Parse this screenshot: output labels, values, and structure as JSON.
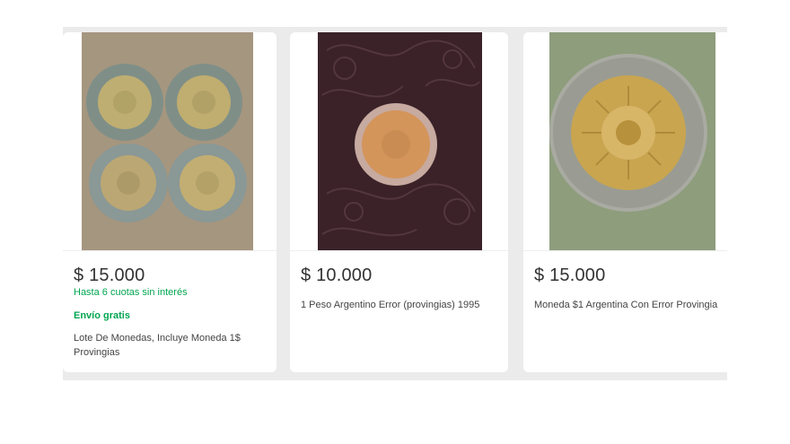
{
  "listings": [
    {
      "price": "$ 15.000",
      "installments": "Hasta 6 cuotas sin interés",
      "shipping": "Envío gratis",
      "title": "Lote De Monedas, Incluye Moneda 1$ Provingias"
    },
    {
      "price": "$ 10.000",
      "title": "1 Peso Argentino Error (provingias) 1995"
    },
    {
      "price": "$ 15.000",
      "title": "Moneda $1 Argentina Con Error Provingia"
    }
  ]
}
